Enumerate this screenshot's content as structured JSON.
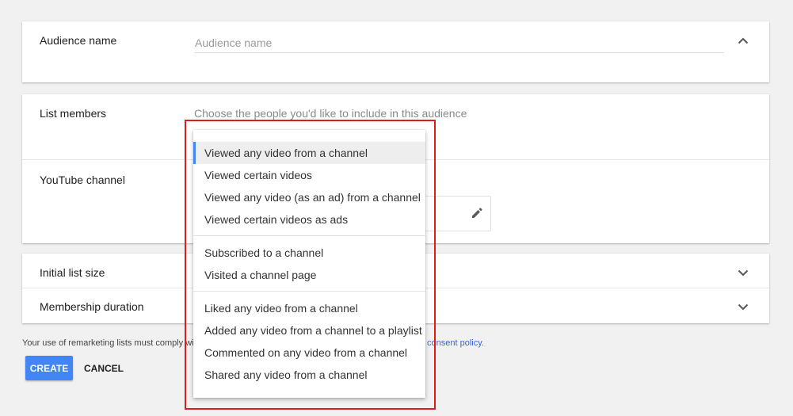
{
  "audience_name": {
    "label": "Audience name",
    "placeholder": "Audience name"
  },
  "list_members": {
    "label": "List members",
    "hint": "Choose the people you'd like to include in this audience"
  },
  "youtube_channel": {
    "label": "YouTube channel"
  },
  "initial_list_size": {
    "label": "Initial list size"
  },
  "membership_duration": {
    "label": "Membership duration"
  },
  "footer": {
    "note": "Your use of remarketing lists must comply wi",
    "policy_link": "consent policy."
  },
  "actions": {
    "create": "CREATE",
    "cancel": "CANCEL"
  },
  "menu": {
    "groups": [
      [
        "Viewed any video from a channel",
        "Viewed certain videos",
        "Viewed any video (as an ad) from a channel",
        "Viewed certain videos as ads"
      ],
      [
        "Subscribed to a channel",
        "Visited a channel page"
      ],
      [
        "Liked any video from a channel",
        "Added any video from a channel to a playlist",
        "Commented on any video from a channel",
        "Shared any video from a channel"
      ]
    ],
    "active": "Viewed any video from a channel"
  },
  "colors": {
    "accent": "#4285f4",
    "highlight": "#e01b1b",
    "link": "#3367d6"
  }
}
